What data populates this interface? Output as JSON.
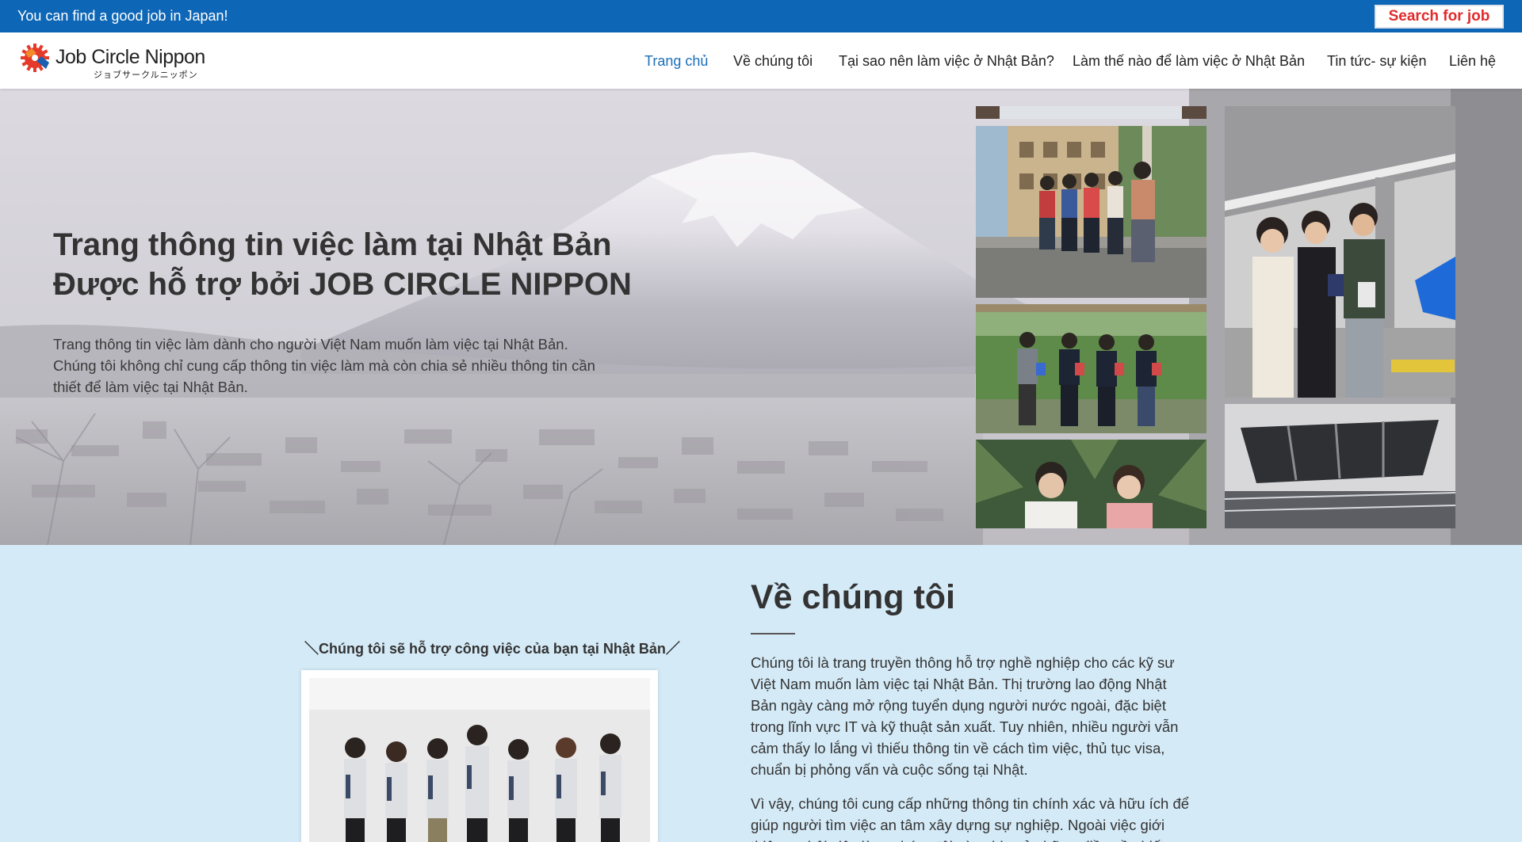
{
  "topbar": {
    "tagline": "You can find a good job in Japan!",
    "search_label": "Search for job",
    "bg_color": "#0d66b6",
    "button_text_color": "#e12b2b"
  },
  "logo": {
    "name": "Job Circle Nippon",
    "kana": "ジョブサークルニッポン"
  },
  "nav": {
    "items": [
      {
        "label": "Trang chủ",
        "active": true
      },
      {
        "label": "Về chúng tôi"
      },
      {
        "label": "Tại sao nên làm việc ở Nhật Bản?"
      },
      {
        "label": "Làm thế nào để làm việc ở Nhật Bản"
      },
      {
        "label": "Tin tức- sự kiện"
      },
      {
        "label": "Liên hệ"
      }
    ],
    "active_color": "#1a6fb9"
  },
  "hero": {
    "title_line1": "Trang thông tin việc làm tại Nhật Bản",
    "title_line2": "Được hỗ trợ bởi JOB CIRCLE NIPPON",
    "desc_line1": "Trang thông tin việc làm dành cho người Việt Nam muốn làm việc tại Nhật Bản.",
    "desc_line2": "Chúng tôi không chỉ cung cấp thông tin việc làm mà còn chia sẻ nhiều thông tin cần",
    "desc_line3": "thiết để làm việc tại Nhật Bản."
  },
  "about": {
    "title": "Về chúng tôi",
    "caption": "＼Chúng tôi sẽ hỗ trợ công việc của bạn tại Nhật Bản／",
    "para1": "Chúng tôi là trang truyền thông hỗ trợ nghề nghiệp cho các kỹ sư Việt Nam muốn làm việc tại Nhật Bản. Thị trường lao động Nhật Bản ngày càng mở rộng tuyển dụng người nước ngoài, đặc biệt trong lĩnh vực IT và kỹ thuật sản xuất. Tuy nhiên, nhiều người vẫn cảm thấy lo lắng vì thiếu thông tin về cách tìm việc, thủ tục visa, chuẩn bị phỏng vấn và cuộc sống tại Nhật.",
    "para2": "Vì vậy, chúng tôi cung cấp những thông tin chính xác và hữu ích để giúp người tìm việc an tâm xây dựng sự nghiệp. Ngoài việc giới thiệu cơ hội việc làm, chúng tôi còn chia sẻ những điều cần biết",
    "bg_color": "#d4eaf7"
  }
}
